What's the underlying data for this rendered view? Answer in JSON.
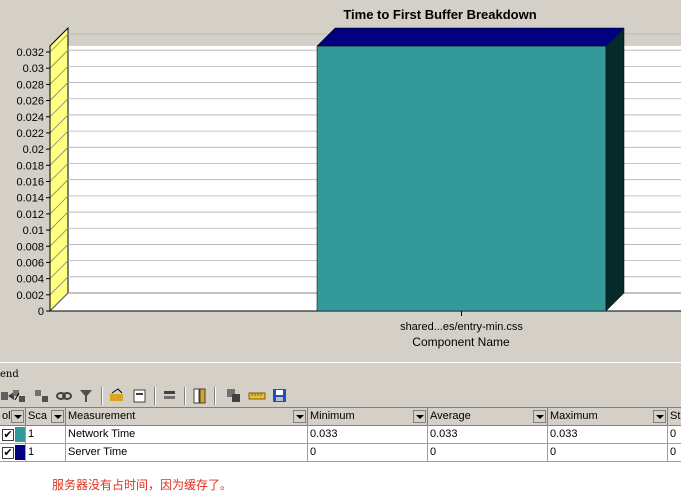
{
  "legend": {
    "title": "end"
  },
  "toolbar": {
    "buttons": [
      "show-icon",
      "hide-icon",
      "toggle-icon",
      "link-icon",
      "filter-icon",
      "highlight-icon",
      "configure-icon",
      "sort-icon",
      "columns-icon",
      "export-icon",
      "ruler-icon",
      "save-icon"
    ]
  },
  "grid": {
    "headers": {
      "color": "ol",
      "scale": "Sca",
      "measurement": "Measurement",
      "minimum": "Minimum",
      "average": "Average",
      "maximum": "Maximum",
      "std": "St"
    },
    "rows": [
      {
        "color": "#339999",
        "scale": "1",
        "measurement": "Network Time",
        "minimum": "0.033",
        "average": "0.033",
        "maximum": "0.033",
        "std": "0",
        "checked": true
      },
      {
        "color": "#000080",
        "scale": "1",
        "measurement": "Server Time",
        "minimum": "0",
        "average": "0",
        "maximum": "0",
        "std": "0",
        "checked": true
      }
    ]
  },
  "note": "服务器没有占时间，因为缓存了。",
  "chart_data": {
    "type": "bar",
    "title": "Time to First Buffer Breakdown",
    "xlabel": "Component Name",
    "ylabel": "",
    "categories": [
      "shared...es/entry-min.css"
    ],
    "series": [
      {
        "name": "Network Time",
        "color": "#339999",
        "values": [
          0.033
        ]
      },
      {
        "name": "Server Time",
        "color": "#000080",
        "values": [
          0
        ]
      }
    ],
    "ylim": [
      0,
      0.032
    ],
    "yticks": [
      "0",
      "0.002",
      "0.004",
      "0.006",
      "0.008",
      "0.01",
      "0.012",
      "0.014",
      "0.016",
      "0.018",
      "0.02",
      "0.022",
      "0.024",
      "0.026",
      "0.028",
      "0.03",
      "0.032"
    ],
    "grid": true,
    "stacked": true
  }
}
